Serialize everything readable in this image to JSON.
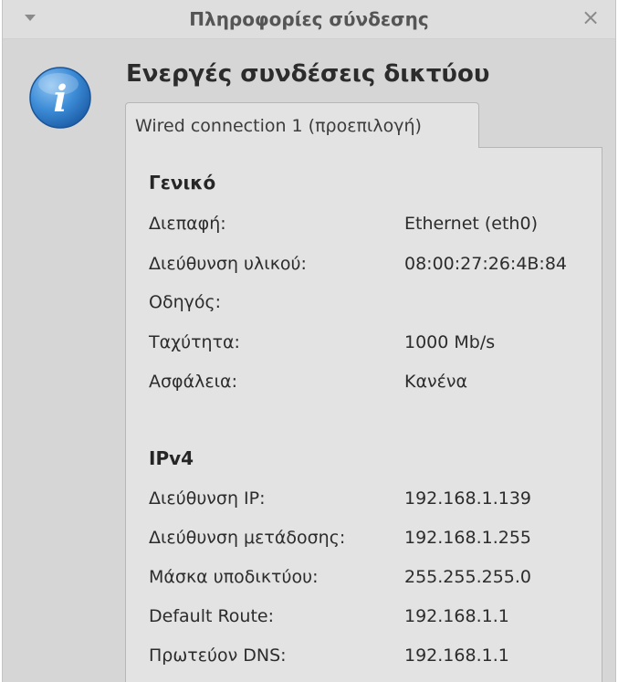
{
  "window": {
    "title": "Πληροφορίες σύνδεσης"
  },
  "heading": "Ενεργές συνδέσεις δικτύου",
  "tabs": [
    {
      "label": "Wired connection 1 (προεπιλογή)",
      "selected": true
    }
  ],
  "sections": {
    "general": {
      "title": "Γενικό",
      "rows": [
        {
          "label": "Διεπαφή:",
          "value": "Ethernet (eth0)"
        },
        {
          "label": "Διεύθυνση υλικού:",
          "value": "08:00:27:26:4B:84"
        },
        {
          "label": "Οδηγός:",
          "value": ""
        },
        {
          "label": "Ταχύτητα:",
          "value": "1000 Mb/s"
        },
        {
          "label": "Ασφάλεια:",
          "value": "Κανένα"
        }
      ]
    },
    "ipv4": {
      "title": "IPv4",
      "rows": [
        {
          "label": "Διεύθυνση IP:",
          "value": "192.168.1.139"
        },
        {
          "label": "Διεύθυνση μετάδοσης:",
          "value": "192.168.1.255"
        },
        {
          "label": "Μάσκα υποδικτύου:",
          "value": "255.255.255.0"
        },
        {
          "label": "Default Route:",
          "value": "192.168.1.1"
        },
        {
          "label": "Πρωτεύον DNS:",
          "value": "192.168.1.1"
        }
      ]
    }
  },
  "icons": {
    "window_menu": "chevron-down-icon",
    "close": "close-icon",
    "info": "info-icon"
  },
  "colors": {
    "info_icon_blue": "#2f7fd0",
    "window_bg": "#d6d6d6",
    "panel_bg": "#e3e3e3"
  }
}
